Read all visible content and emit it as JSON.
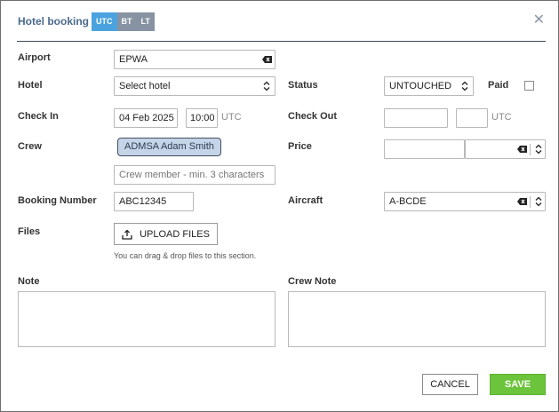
{
  "header": {
    "title": "Hotel booking",
    "tz_utc": "UTC",
    "tz_bt": "BT",
    "tz_lt": "LT",
    "close_glyph": "✕"
  },
  "airport": {
    "label": "Airport",
    "value": "EPWA"
  },
  "hotel": {
    "label": "Hotel",
    "value": "Select hotel"
  },
  "status": {
    "label": "Status",
    "value": "UNTOUCHED"
  },
  "paid": {
    "label": "Paid",
    "checked": false
  },
  "check_in": {
    "label": "Check In",
    "date": "04 Feb 2025",
    "time": "10:00",
    "tz": "UTC"
  },
  "check_out": {
    "label": "Check Out",
    "date": "",
    "time": "",
    "tz": "UTC"
  },
  "crew": {
    "label": "Crew",
    "chip": "ADMSA Adam Smith",
    "placeholder": "Crew member - min. 3 characters"
  },
  "price": {
    "label": "Price",
    "amount": "",
    "currency": ""
  },
  "booking_number": {
    "label": "Booking Number",
    "value": "ABC12345"
  },
  "aircraft": {
    "label": "Aircraft",
    "value": "A-BCDE"
  },
  "files": {
    "label": "Files",
    "button": "UPLOAD FILES",
    "hint": "You can drag & drop files to this section."
  },
  "note": {
    "label": "Note",
    "value": ""
  },
  "crew_note": {
    "label": "Crew Note",
    "value": ""
  },
  "actions": {
    "cancel": "CANCEL",
    "save": "SAVE"
  },
  "colors": {
    "accent": "#4aa3df",
    "save": "#6cc33c",
    "title": "#4a6a8c",
    "chip_bg": "#c6d4e8"
  },
  "icons": {
    "clear": "backspace-clear-icon",
    "select": "updown-chevron-icon",
    "upload": "upload-icon",
    "close": "close-icon"
  }
}
